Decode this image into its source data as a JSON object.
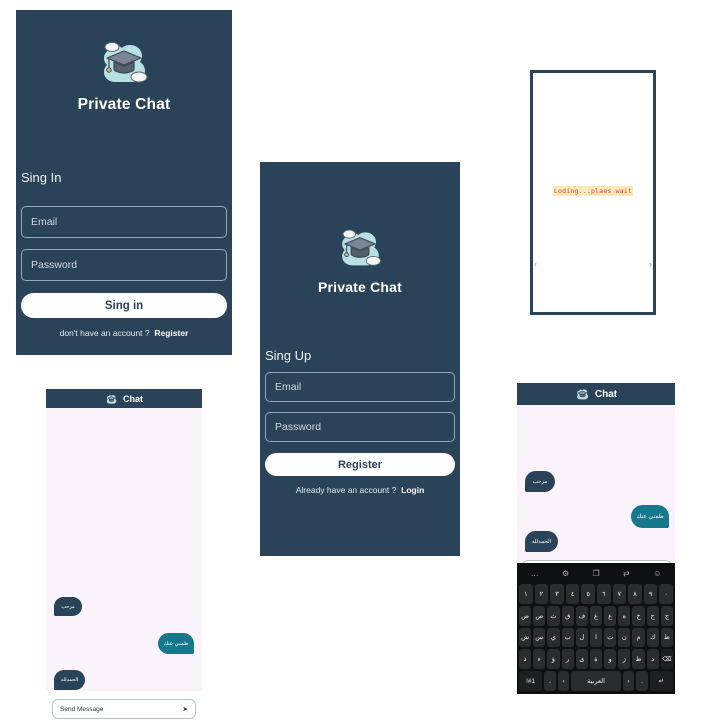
{
  "app": {
    "brand": "Private Chat",
    "logo_icon": "graduation-cap-cloud-logo"
  },
  "signin_screen": {
    "title": "Private Chat",
    "section_label": "Sing In",
    "email_placeholder": "Email",
    "password_placeholder": "Password",
    "submit_label": "Sing in",
    "footer_text": "don't have an account ?",
    "footer_link": "Register"
  },
  "signup_screen": {
    "title": "Private Chat",
    "section_label": "Sing Up",
    "email_placeholder": "Email",
    "password_placeholder": "Password",
    "submit_label": "Register",
    "footer_text": "Already have an account ?",
    "footer_link": "Login"
  },
  "loading_screen": {
    "message": "Loding...plaes wait",
    "text_color": "#e8452b",
    "highlight_color": "#fde9b8",
    "left_handle": "‹",
    "right_handle": "›"
  },
  "chat_screen": {
    "header_title": "Chat",
    "header_icon": "graduation-cap-cloud-logo",
    "bubbles": [
      {
        "text": "مرحب",
        "side": "received"
      },
      {
        "text": "طمني عنك",
        "side": "sent"
      },
      {
        "text": "الحمدلله",
        "side": "received"
      }
    ],
    "input_placeholder": "Send Message",
    "send_icon": "➤",
    "colors": {
      "header": "#2b4358",
      "body": "#faf3fb",
      "received_bubble": "#2b4358",
      "sent_bubble": "#15788c"
    }
  },
  "keyboard": {
    "toolbar": [
      "…",
      "⚙",
      "❐",
      "⇄",
      "☺"
    ],
    "toolbar_names": [
      "more-icon",
      "gear-icon",
      "clipboard-icon",
      "translate-icon",
      "sticker-icon"
    ],
    "row1": [
      "١",
      "٢",
      "٣",
      "٤",
      "٥",
      "٦",
      "٧",
      "٨",
      "٩",
      "٠"
    ],
    "row2": [
      "ض",
      "ص",
      "ث",
      "ق",
      "ف",
      "غ",
      "ع",
      "ه",
      "خ",
      "ح",
      "ج"
    ],
    "row3": [
      "ش",
      "س",
      "ي",
      "ب",
      "ل",
      "ا",
      "ت",
      "ن",
      "م",
      "ك",
      "ط"
    ],
    "row4": [
      "ذ",
      "ء",
      "ؤ",
      "ر",
      "ى",
      "ة",
      "و",
      "ز",
      "ظ",
      "د",
      "⌫"
    ],
    "row5": [
      "!#1",
      "،",
      "‹",
      "العربية",
      "›",
      ".",
      "↵"
    ],
    "row5_names": [
      "symbols-key",
      "comma-key",
      "prev-key",
      "space-key",
      "next-key",
      "period-key",
      "enter-key"
    ]
  }
}
